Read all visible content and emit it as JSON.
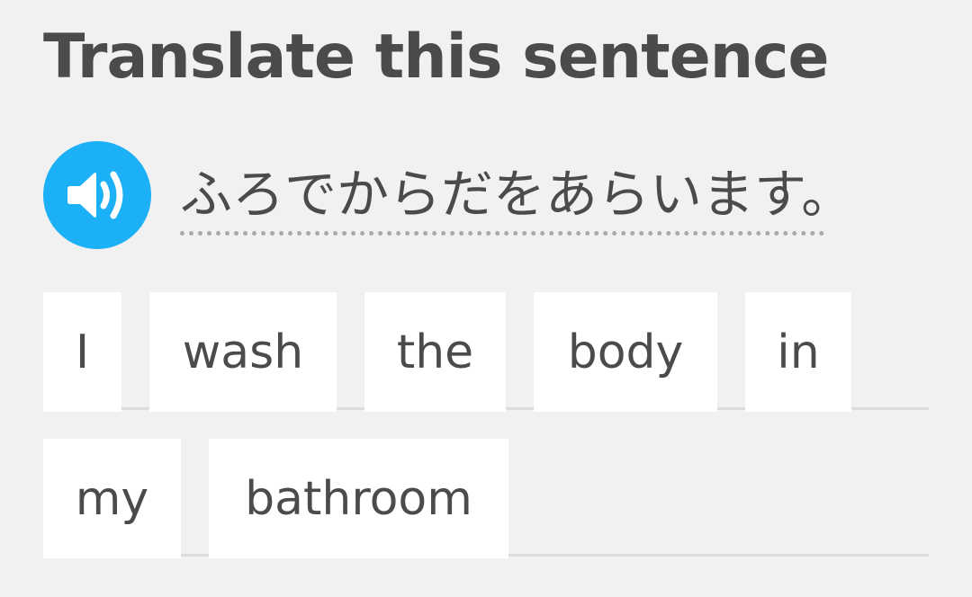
{
  "header": {
    "title": "Translate this sentence"
  },
  "prompt": {
    "audio_icon": "speaker-icon",
    "sentence": "ふろでからだをあらいます。"
  },
  "word_bank": {
    "row1": [
      "I",
      "wash",
      "the",
      "body",
      "in"
    ],
    "row2": [
      "my",
      "bathroom"
    ]
  },
  "colors": {
    "background": "#f1f1f1",
    "text": "#4b4b4b",
    "accent": "#1cb0f6",
    "tile": "#ffffff",
    "divider": "#dcdcdc"
  }
}
